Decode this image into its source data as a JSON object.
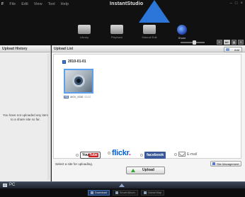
{
  "app": {
    "brand": "InstantStudio",
    "menu": [
      "F",
      "File",
      "Edit",
      "View",
      "Tool",
      "Help"
    ],
    "window_controls": [
      "–",
      "□",
      "×"
    ]
  },
  "modes": [
    {
      "label": "Library",
      "icon": "library-icon"
    },
    {
      "label": "Playback",
      "icon": "playback-icon"
    },
    {
      "label": "Manual Edit",
      "icon": "manual-edit-icon"
    },
    {
      "label": "Share",
      "icon": "share-icon",
      "active": true
    }
  ],
  "view_controls": {
    "all_label": "All"
  },
  "left_panel": {
    "title": "Upload History",
    "message": "You have not uploaded any item to a share site so far."
  },
  "main": {
    "title": "Upload List",
    "add_label": "Add",
    "date_group": "2010-01-01",
    "items": [
      {
        "badge": "HD",
        "name": "MOV_0036",
        "duration": "00:02"
      }
    ]
  },
  "sites": {
    "hint": "Select a site for uploading.",
    "management_label": "Site Management",
    "youtube": {
      "you": "You",
      "tube": "Tube"
    },
    "flickr": {
      "main": "flickr",
      "dot": "."
    },
    "facebook": "facebook",
    "email": "E-mail",
    "upload_label": "Upload"
  },
  "footer": {
    "pc_label": "PC",
    "tabs": [
      {
        "label": "Download",
        "active": true
      },
      {
        "label": "Smart Album",
        "active": false
      },
      {
        "label": "Global Map",
        "active": false
      }
    ]
  },
  "colors": {
    "accent": "#2b76d8",
    "selection": "#5aa0ef",
    "facebook": "#3b5998",
    "flickr_blue": "#0063dc",
    "flickr_pink": "#ff0084",
    "upload_arrow": "#2fa52f"
  }
}
